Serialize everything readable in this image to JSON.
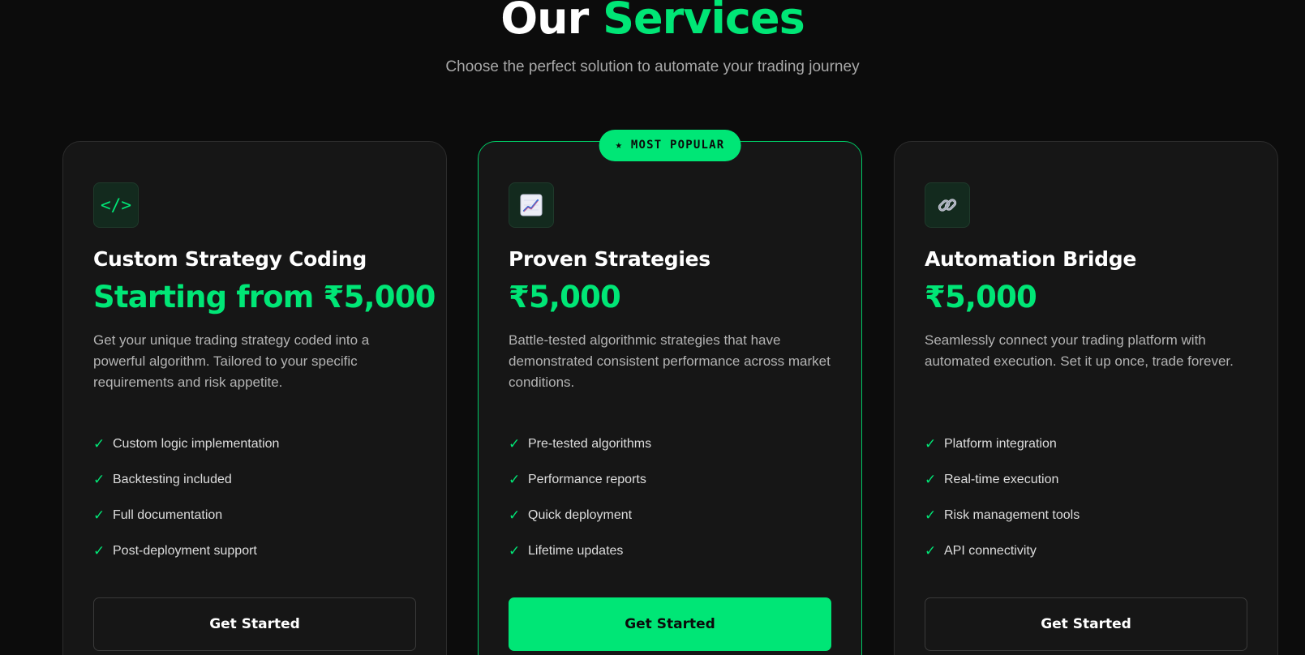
{
  "header": {
    "title_prefix": "Our",
    "title_accent": "Services",
    "subtitle": "Choose the perfect solution to automate your trading journey"
  },
  "colors": {
    "background": "#0c0c0c",
    "card": "#161616",
    "accent": "#00e676"
  },
  "cards": [
    {
      "icon": "code-icon",
      "title": "Custom Strategy Coding",
      "price": "Starting from ₹5,000",
      "description": "Get your unique trading strategy coded into a powerful algorithm. Tailored to your specific requirements and risk appetite.",
      "features": [
        "Custom logic implementation",
        "Backtesting included",
        "Full documentation",
        "Post-deployment support"
      ],
      "cta": "Get Started"
    },
    {
      "badge": "★ MOST POPULAR",
      "icon": "chart-icon",
      "title": "Proven Strategies",
      "price": "₹5,000",
      "description": "Battle-tested algorithmic strategies that have demonstrated consistent performance across market conditions.",
      "features": [
        "Pre-tested algorithms",
        "Performance reports",
        "Quick deployment",
        "Lifetime updates"
      ],
      "cta": "Get Started"
    },
    {
      "icon": "link-icon",
      "title": "Automation Bridge",
      "price": "₹5,000",
      "description": "Seamlessly connect your trading platform with automated execution. Set it up once, trade forever.",
      "features": [
        "Platform integration",
        "Real-time execution",
        "Risk management tools",
        "API connectivity"
      ],
      "cta": "Get Started"
    }
  ]
}
